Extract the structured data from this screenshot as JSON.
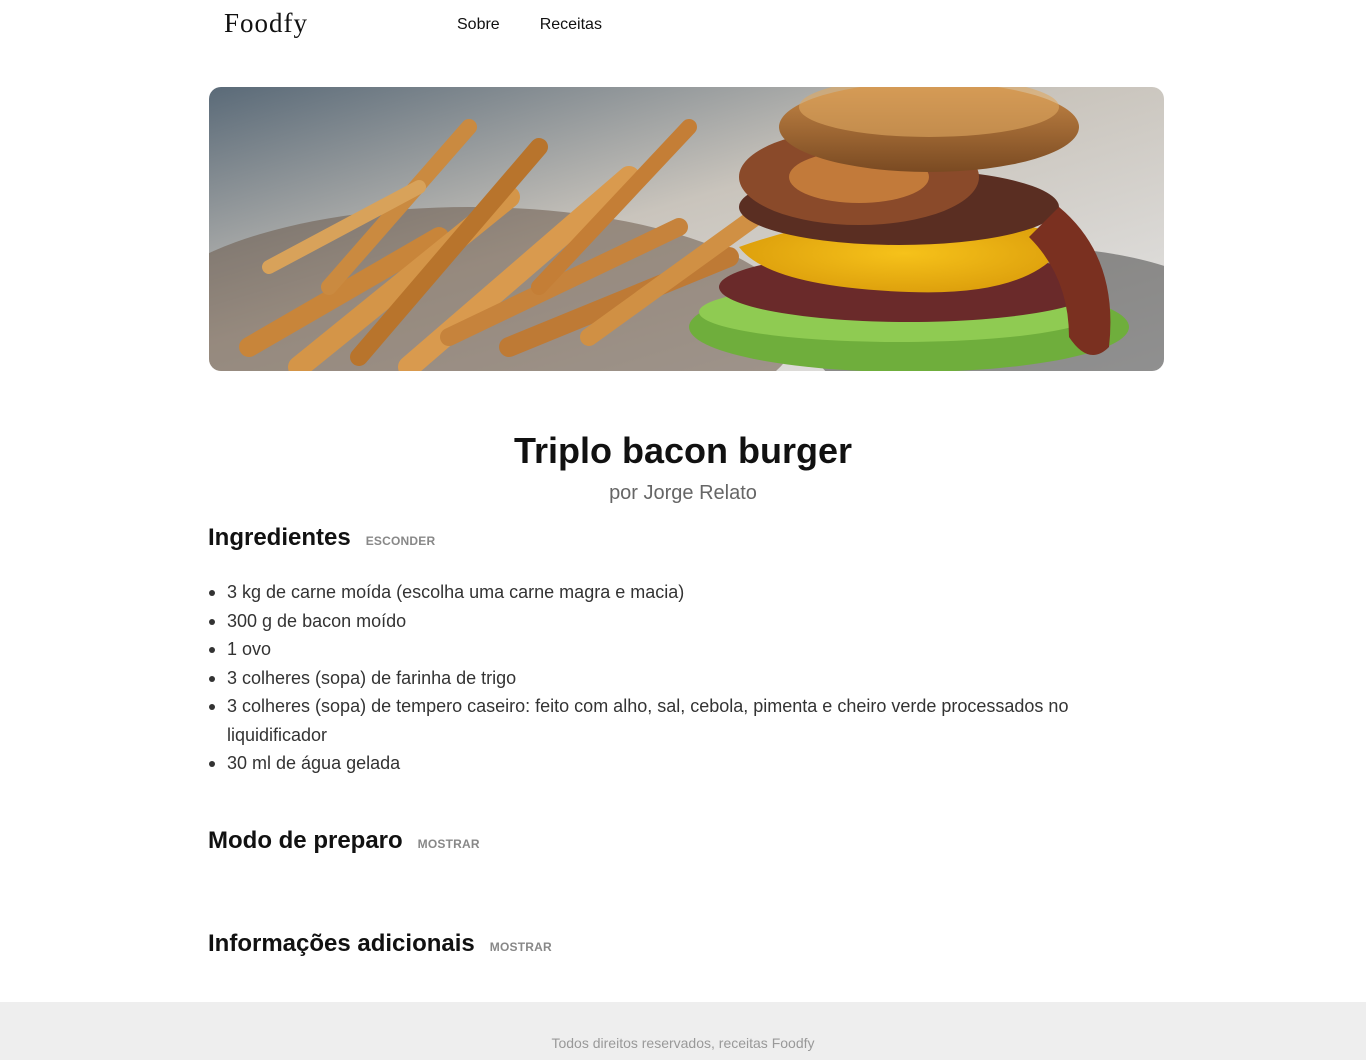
{
  "header": {
    "logo": "Foodfy",
    "nav": [
      {
        "label": "Sobre"
      },
      {
        "label": "Receitas"
      }
    ]
  },
  "recipe": {
    "title": "Triplo bacon burger",
    "author": "por Jorge Relato",
    "image_icon": "burger-photo"
  },
  "sections": {
    "ingredients": {
      "title": "Ingredientes",
      "toggle": "ESCONDER",
      "items": [
        "3 kg de carne moída (escolha uma carne magra e macia)",
        "300 g de bacon moído",
        "1 ovo",
        "3 colheres (sopa) de farinha de trigo",
        "3 colheres (sopa) de tempero caseiro: feito com alho, sal, cebola, pimenta e cheiro verde processados no liquidificador",
        "30 ml de água gelada"
      ]
    },
    "preparation": {
      "title": "Modo de preparo",
      "toggle": "MOSTRAR"
    },
    "additional": {
      "title": "Informações adicionais",
      "toggle": "MOSTRAR"
    }
  },
  "footer": {
    "text": "Todos direitos reservados, receitas Foodfy"
  },
  "colors": {
    "text": "#111111",
    "muted": "#666666",
    "toggle": "#888888",
    "footer_bg": "#eeeeee"
  }
}
